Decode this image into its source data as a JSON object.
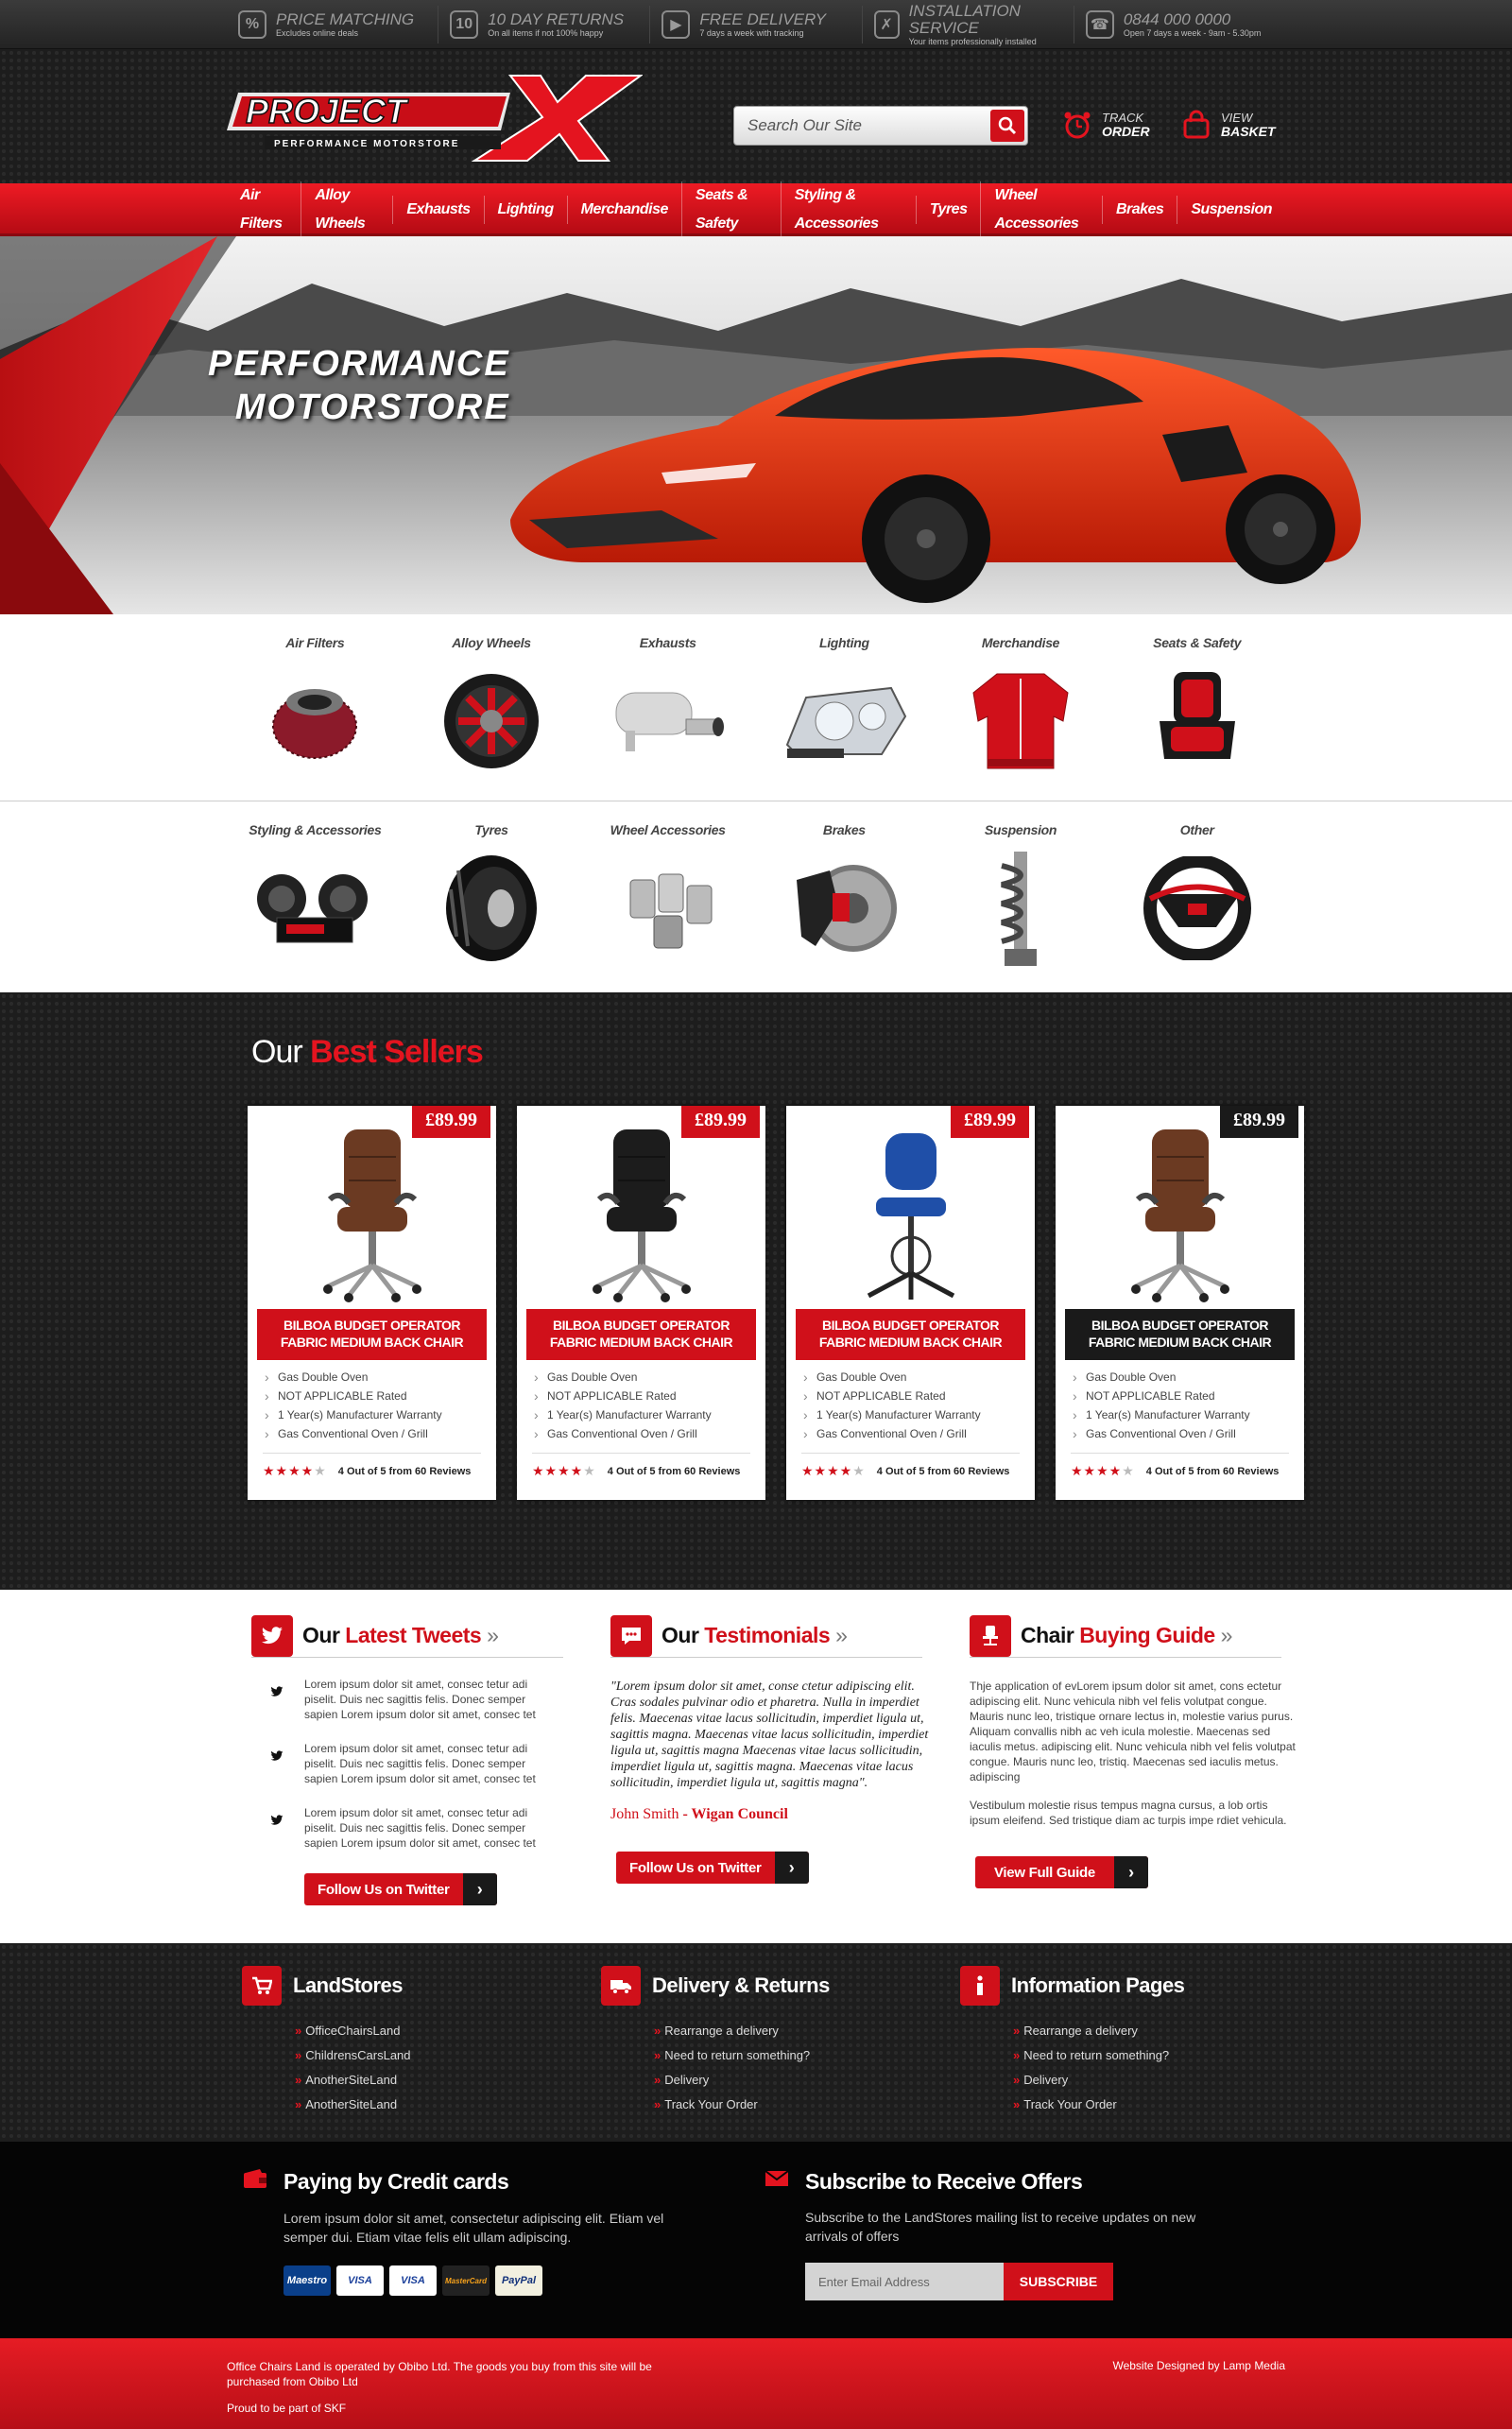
{
  "topbar": [
    {
      "icon": "tag-icon",
      "title": "PRICE MATCHING",
      "sub": "Excludes online deals"
    },
    {
      "icon": "calendar-icon",
      "title": "10 DAY RETURNS",
      "sub": "On all items if not 100% happy"
    },
    {
      "icon": "truck-icon",
      "title": "FREE DELIVERY",
      "sub": "7 days a week with tracking"
    },
    {
      "icon": "wrench-icon",
      "title": "INSTALLATION SERVICE",
      "sub": "Your items professionally installed"
    },
    {
      "icon": "phone-icon",
      "title": "0844 000 0000",
      "sub": "Open 7 days a week - 9am - 5.30pm"
    }
  ],
  "header": {
    "logo_text": "PROJECT",
    "logo_x": "X",
    "logo_tagline": "PERFORMANCE MOTORSTORE",
    "search_placeholder": "Search Our Site",
    "track_l1": "TRACK",
    "track_l2": "ORDER",
    "basket_l1": "VIEW",
    "basket_l2": "BASKET"
  },
  "nav": [
    "Air Filters",
    "Alloy Wheels",
    "Exhausts",
    "Lighting",
    "Merchandise",
    "Seats & Safety",
    "Styling & Accessories",
    "Tyres",
    "Wheel Accessories",
    "Brakes",
    "Suspension"
  ],
  "hero": {
    "line1": "PERFORMANCE",
    "line2": "MOTORSTORE"
  },
  "categories_row1": [
    "Air Filters",
    "Alloy Wheels",
    "Exhausts",
    "Lighting",
    "Merchandise",
    "Seats & Safety"
  ],
  "categories_row2": [
    "Styling & Accessories",
    "Tyres",
    "Wheel Accessories",
    "Brakes",
    "Suspension",
    "Other"
  ],
  "best": {
    "title_a": "Our",
    "title_b": "Best Sellers",
    "products": [
      {
        "price": "£89.99",
        "name": "BILBOA BUDGET OPERATOR FABRIC MEDIUM BACK CHAIR",
        "features": [
          "Gas Double Oven",
          "NOT APPLICABLE Rated",
          "1 Year(s) Manufacturer Warranty",
          "Gas Conventional Oven / Grill"
        ],
        "rating": 4,
        "reviews": "4 Out of 5 from 60 Reviews"
      },
      {
        "price": "£89.99",
        "name": "BILBOA BUDGET OPERATOR FABRIC MEDIUM BACK CHAIR",
        "features": [
          "Gas Double Oven",
          "NOT APPLICABLE Rated",
          "1 Year(s) Manufacturer Warranty",
          "Gas Conventional Oven / Grill"
        ],
        "rating": 4,
        "reviews": "4 Out of 5 from 60 Reviews"
      },
      {
        "price": "£89.99",
        "name": "BILBOA BUDGET OPERATOR FABRIC MEDIUM BACK CHAIR",
        "features": [
          "Gas Double Oven",
          "NOT APPLICABLE Rated",
          "1 Year(s) Manufacturer Warranty",
          "Gas Conventional Oven / Grill"
        ],
        "rating": 4,
        "reviews": "4 Out of 5 from 60 Reviews"
      },
      {
        "price": "£89.99",
        "name": "BILBOA BUDGET OPERATOR FABRIC MEDIUM BACK CHAIR",
        "features": [
          "Gas Double Oven",
          "NOT APPLICABLE Rated",
          "1 Year(s) Manufacturer Warranty",
          "Gas Conventional Oven / Grill"
        ],
        "rating": 4,
        "reviews": "4 Out of 5 from 60 Reviews"
      }
    ]
  },
  "tweets": {
    "title_a": "Our",
    "title_b": "Latest Tweets",
    "raquo": "»",
    "items": [
      "Lorem ipsum dolor sit amet, consec tetur adi piselit. Duis nec sagittis felis. Donec semper sapien Lorem ipsum dolor sit amet, consec tet",
      "Lorem ipsum dolor sit amet, consec tetur adi piselit. Duis nec sagittis felis. Donec semper sapien Lorem ipsum dolor sit amet, consec tet",
      "Lorem ipsum dolor sit amet, consec tetur adi piselit. Duis nec sagittis felis. Donec semper sapien Lorem ipsum dolor sit amet, consec tet"
    ],
    "button": "Follow Us on Twitter"
  },
  "testimonials": {
    "title_a": "Our",
    "title_b": "Testimonials",
    "quote": "\"Lorem ipsum dolor sit amet, conse ctetur adipiscing elit. Cras sodales pulvinar odio et pharetra. Nulla in imperdiet felis. Maecenas vitae lacus sollicitudin, imperdiet ligula ut, sagittis magna. Maecenas vitae lacus sollicitudin, imperdiet ligula ut, sagittis magna Maecenas vitae lacus sollicitudin, imperdiet ligula ut, sagittis magna. Maecenas vitae lacus sollicitudin, imperdiet ligula ut, sagittis magna\".",
    "author": "John Smith",
    "company": " - Wigan Council",
    "button": "Follow Us on Twitter"
  },
  "guide": {
    "title_a": "Chair",
    "title_b": "Buying Guide",
    "p1": "Thje application of evLorem ipsum dolor sit amet, cons ectetur adipiscing elit. Nunc vehicula nibh vel felis volutpat congue. Mauris nunc leo, tristique ornare lectus in, molestie varius purus. Aliquam convallis nibh ac veh icula molestie. Maecenas sed iaculis metus. adipiscing elit. Nunc vehicula nibh vel felis volutpat congue. Mauris nunc leo, tristiq. Maecenas sed iaculis metus. adipiscing",
    "p2": "Vestibulum molestie risus tempus magna cursus, a lob ortis ipsum eleifend. Sed tristique diam ac turpis impe rdiet vehicula.",
    "button": "View Full Guide"
  },
  "footer_links": [
    {
      "title": "LandStores",
      "icon": "cart-icon",
      "items": [
        "OfficeChairsLand",
        "ChildrensCarsLand",
        "AnotherSiteLand",
        "AnotherSiteLand"
      ]
    },
    {
      "title": "Delivery & Returns",
      "icon": "truck-icon",
      "items": [
        "Rearrange a delivery",
        "Need to return something?",
        "Delivery",
        "Track Your Order"
      ]
    },
    {
      "title": "Information Pages",
      "icon": "info-icon",
      "items": [
        "Rearrange a delivery",
        "Need to return something?",
        "Delivery",
        "Track Your Order"
      ]
    }
  ],
  "payment": {
    "title": "Paying by Credit cards",
    "text": "Lorem ipsum dolor sit amet, consectetur adipiscing elit. Etiam vel semper dui. Etiam vitae felis elit ullam adipiscing.",
    "cards": [
      "Maestro",
      "VISA",
      "VISA",
      "MasterCard",
      "PayPal"
    ]
  },
  "subscribe": {
    "title": "Subscribe to Receive Offers",
    "text": "Subscribe to the LandStores mailing list to receive updates on new arrivals of offers",
    "placeholder": "Enter Email Address",
    "button": "SUBSCRIBE"
  },
  "bottom": {
    "left1": "Office Chairs Land is operated by Obibo Ltd. The goods you buy from this site will be purchased from Obibo Ltd",
    "left2": "Proud to be part of SKF",
    "right": "Website Designed by Lamp Media"
  },
  "colors": {
    "accent": "#d0101a",
    "dark": "#1d1d1d"
  }
}
